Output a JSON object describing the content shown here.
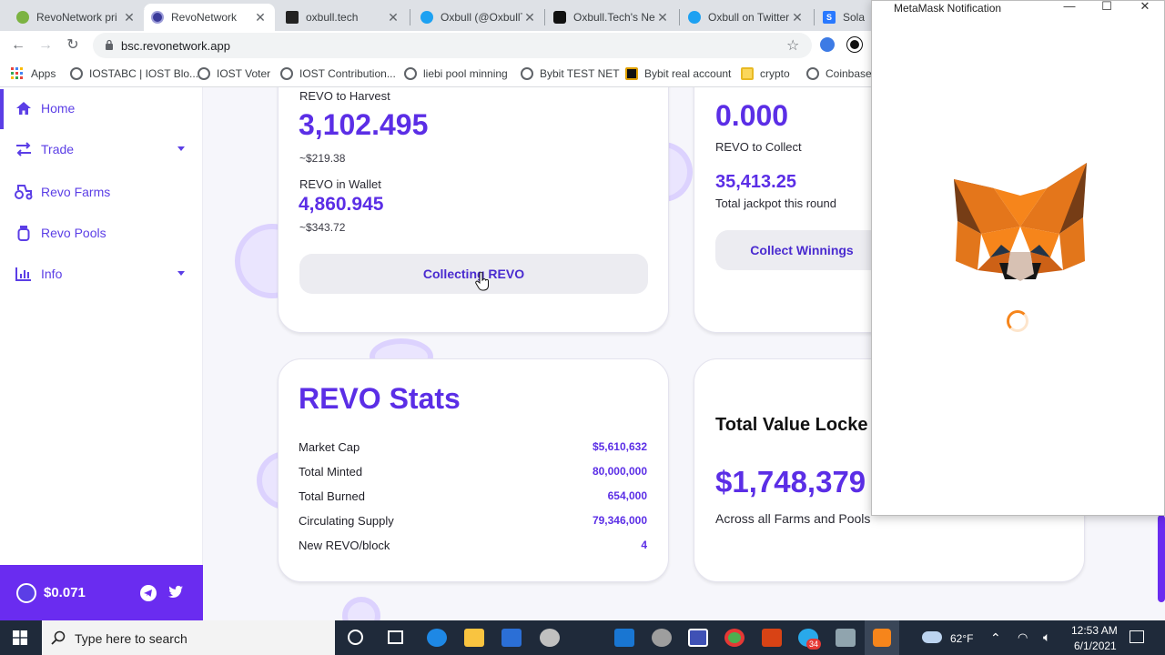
{
  "tabs": [
    {
      "title": "RevoNetwork pri",
      "color": "#7cb342"
    },
    {
      "title": "RevoNetwork",
      "color": "#3b3b9a"
    },
    {
      "title": "oxbull.tech",
      "color": "#222222"
    },
    {
      "title": "Oxbull (@OxbullT",
      "color": "#1da1f2"
    },
    {
      "title": "Oxbull.Tech's Ne",
      "color": "#111111"
    },
    {
      "title": "Oxbull on Twitter",
      "color": "#1da1f2"
    },
    {
      "title": "Solana",
      "color": "#2979ff"
    }
  ],
  "tab_letters": {
    "solana": "S"
  },
  "address": {
    "url": "bsc.revonetwork.app"
  },
  "bookmarks": [
    "Apps",
    "IOSTABC | IOST Blo...",
    "IOST Voter",
    "IOST Contribution...",
    "liebi pool minning",
    "Bybit TEST NET",
    "Bybit real account",
    "crypto",
    "Coinbase"
  ],
  "sidebar": {
    "items": [
      {
        "label": "Home"
      },
      {
        "label": "Trade"
      },
      {
        "label": "Revo Farms"
      },
      {
        "label": "Revo Pools"
      },
      {
        "label": "Info"
      }
    ],
    "price": "$0.071"
  },
  "harvest_card": {
    "label": "REVO to Harvest",
    "amount": "3,102.495",
    "amount_usd": "~$219.38",
    "wallet_label": "REVO in Wallet",
    "wallet_amount": "4,860.945",
    "wallet_usd": "~$343.72",
    "button": "Collecting REVO"
  },
  "lottery_card": {
    "amount": "0.000",
    "label": "REVO to Collect",
    "jackpot": "35,413.25",
    "jackpot_label": "Total jackpot this round",
    "button": "Collect Winnings"
  },
  "stats_card": {
    "title": "REVO Stats",
    "rows": [
      {
        "label": "Market Cap",
        "value": "$5,610,632"
      },
      {
        "label": "Total Minted",
        "value": "80,000,000"
      },
      {
        "label": "Total Burned",
        "value": "654,000"
      },
      {
        "label": "Circulating Supply",
        "value": "79,346,000"
      },
      {
        "label": "New REVO/block",
        "value": "4"
      }
    ]
  },
  "tvl_card": {
    "title": "Total Value Locke",
    "amount": "$1,748,379",
    "sub": "Across all Farms and Pools"
  },
  "metamask": {
    "title": "MetaMask Notification"
  },
  "taskbar": {
    "search_placeholder": "Type here to search",
    "weather": "62°F",
    "time": "12:53 AM",
    "date": "6/1/2021",
    "badge": "34"
  }
}
